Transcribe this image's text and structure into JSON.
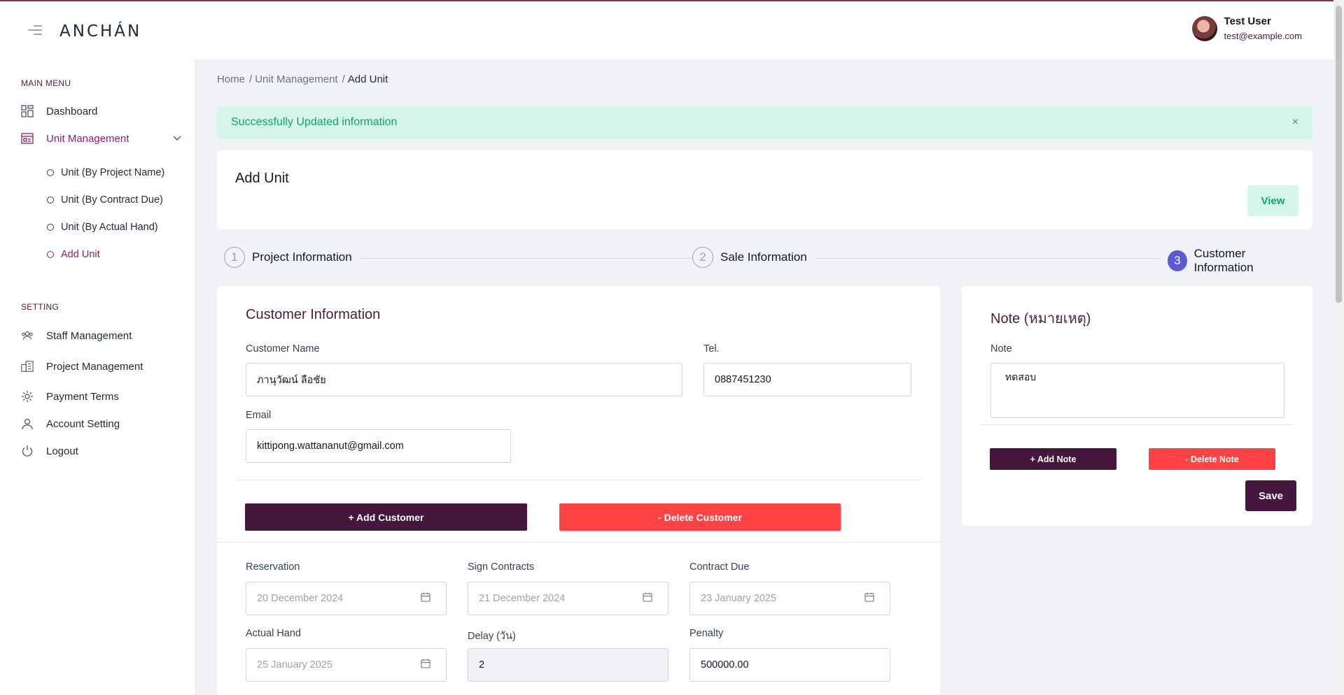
{
  "app": {
    "logo": "ANCHÁN"
  },
  "user": {
    "name": "Test User",
    "email": "test@example.com"
  },
  "sidebar": {
    "main_menu_title": "MAIN MENU",
    "dashboard": "Dashboard",
    "unit_management": "Unit Management",
    "sub_items": [
      "Unit (By Project Name)",
      "Unit (By Contract Due)",
      "Unit (By Actual Hand)",
      "Add Unit"
    ],
    "setting_title": "SETTING",
    "settings": [
      "Staff Management",
      "Project Management",
      "Payment Terms",
      "Account Setting",
      "Logout"
    ]
  },
  "breadcrumb": {
    "items": [
      "Home",
      "Unit Management",
      "Add Unit"
    ],
    "separator": "/"
  },
  "alert": {
    "text": "Successfully Updated information",
    "close": "×"
  },
  "header": {
    "title": "Add Unit",
    "view_label": "View"
  },
  "stepper": {
    "steps": [
      {
        "num": "1",
        "label": "Project Information"
      },
      {
        "num": "2",
        "label": "Sale Information"
      },
      {
        "num": "3",
        "label": "Customer Information"
      }
    ],
    "active": 3
  },
  "customer": {
    "heading": "Customer Information",
    "name_label": "Customer Name",
    "name_value": "ภานุวัฒน์ ลือชัย",
    "tel_label": "Tel.",
    "tel_value": "0887451230",
    "email_label": "Email",
    "email_value": "kittipong.wattananut@gmail.com",
    "add_label": "+ Add Customer",
    "delete_label": "- Delete Customer"
  },
  "dates": {
    "reservation_label": "Reservation",
    "reservation_value": "20 December 2024",
    "sign_label": "Sign Contracts",
    "sign_value": "21 December 2024",
    "due_label": "Contract Due",
    "due_value": "23 January 2025",
    "actual_label": "Actual Hand",
    "actual_value": "25 January 2025",
    "delay_label": "Delay (วัน)",
    "delay_value": "2",
    "penalty_label": "Penalty",
    "penalty_value": "500000.00"
  },
  "note": {
    "heading": "Note (หมายเหตุ)",
    "label": "Note",
    "value": "ทดสอบ",
    "add_label": "+ Add Note",
    "delete_label": "- Delete Note",
    "save_label": "Save"
  },
  "colors": {
    "brand": "#45173d",
    "accent_purple": "#8b1f75",
    "danger": "#ff4343",
    "success_bg": "#d6f5ea",
    "success_text": "#10a36b",
    "step_active": "#5b5bd6"
  },
  "icons": {
    "menu": "hamburger-icon",
    "dashboard": "grid-icon",
    "unit_management": "building-card-icon",
    "chevron": "chevron-down-icon",
    "staff": "users-icon",
    "project": "city-icon",
    "payment": "gear-icon",
    "account": "user-icon",
    "logout": "power-icon",
    "calendar": "calendar-icon"
  }
}
